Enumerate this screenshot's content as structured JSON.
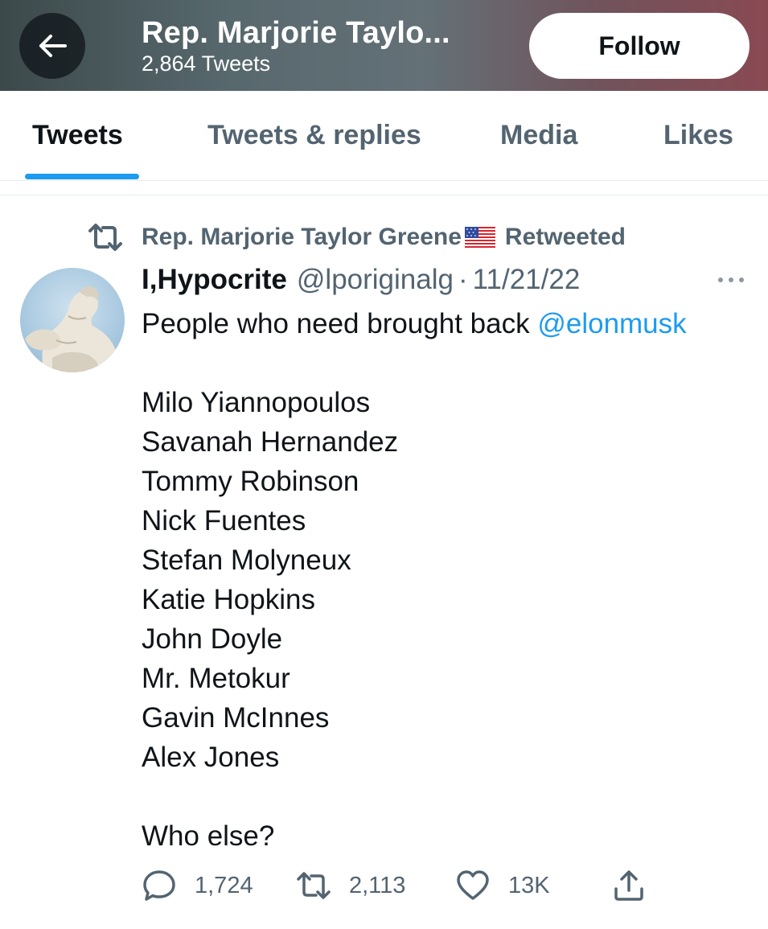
{
  "header": {
    "title": "Rep. Marjorie Taylo...",
    "tweet_count": "2,864 Tweets",
    "follow_label": "Follow"
  },
  "tabs": [
    {
      "label": "Tweets",
      "active": true
    },
    {
      "label": "Tweets & replies",
      "active": false
    },
    {
      "label": "Media",
      "active": false
    },
    {
      "label": "Likes",
      "active": false
    }
  ],
  "retweet_banner": {
    "name": "Rep. Marjorie Taylor Greene",
    "label": "Retweeted"
  },
  "tweet": {
    "display_name": "I,Hypocrite",
    "handle": "@lporiginalg",
    "date": "11/21/22",
    "text_intro": "People who need brought back",
    "mention": "@elonmusk",
    "names": [
      "Milo Yiannopoulos",
      "Savanah Hernandez",
      "Tommy Robinson",
      "Nick Fuentes",
      "Stefan Molyneux",
      "Katie Hopkins",
      "John Doyle",
      "Mr. Metokur",
      "Gavin McInnes",
      "Alex Jones"
    ],
    "closing": "Who else?",
    "stats": {
      "replies": "1,724",
      "retweets": "2,113",
      "likes": "13K"
    }
  },
  "colors": {
    "accent": "#1d9bf0",
    "text_primary": "#0f1419",
    "text_secondary": "#536471"
  }
}
